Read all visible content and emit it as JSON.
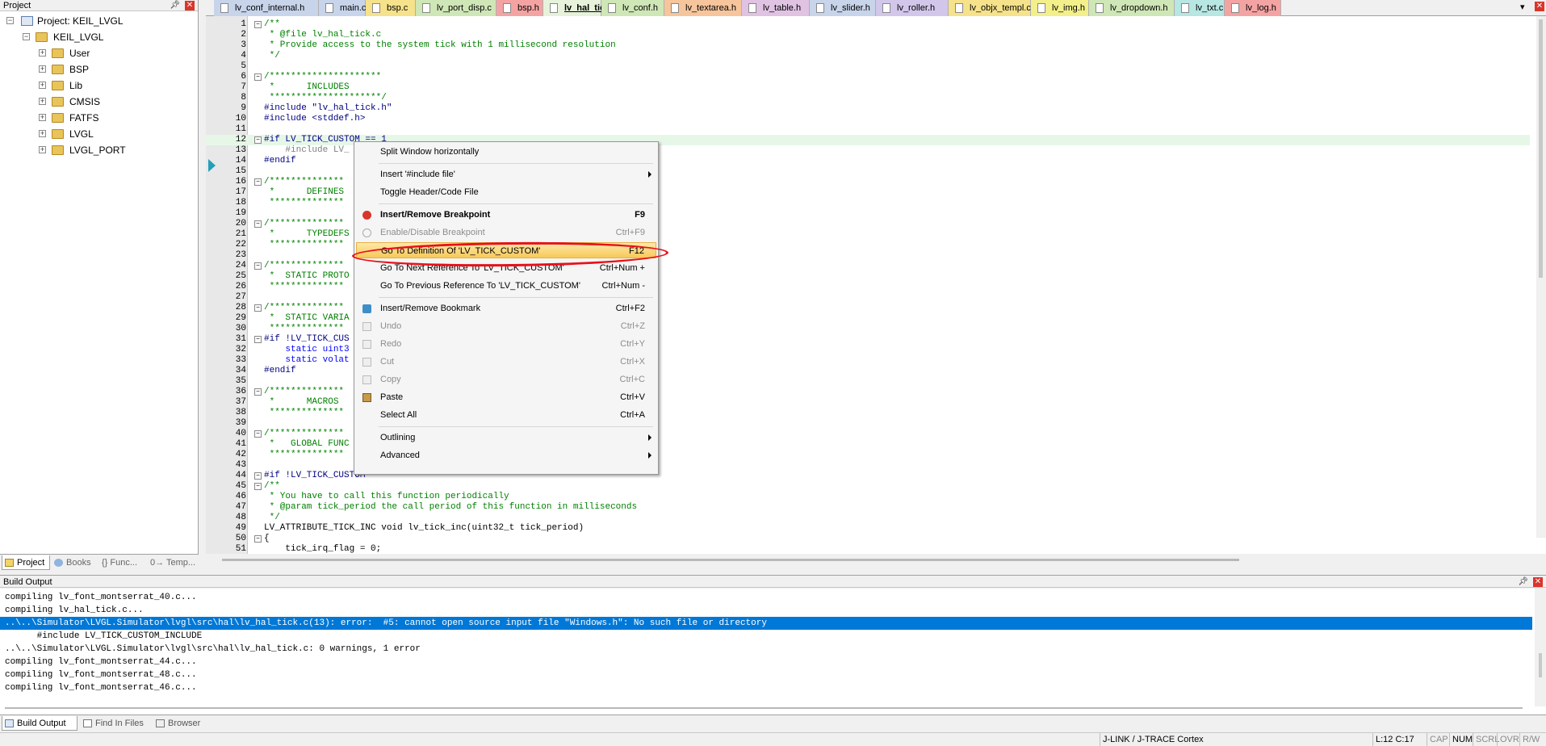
{
  "project_panel": {
    "title": "Project",
    "tree": [
      {
        "label": "Project: KEIL_LVGL",
        "kind": "project"
      },
      {
        "label": "KEIL_LVGL",
        "kind": "target"
      },
      {
        "label": "User",
        "kind": "folder"
      },
      {
        "label": "BSP",
        "kind": "folder"
      },
      {
        "label": "Lib",
        "kind": "folder"
      },
      {
        "label": "CMSIS",
        "kind": "folder"
      },
      {
        "label": "FATFS",
        "kind": "folder"
      },
      {
        "label": "LVGL",
        "kind": "folder"
      },
      {
        "label": "LVGL_PORT",
        "kind": "folder"
      }
    ],
    "tabs": [
      "Project",
      "Books",
      "{} Func...",
      "0→ Temp..."
    ]
  },
  "file_tabs": [
    {
      "label": "lv_conf_internal.h",
      "color": "#c7d4ea"
    },
    {
      "label": "main.c",
      "color": "#c7d4ea"
    },
    {
      "label": "bsp.c",
      "color": "#f6e28a"
    },
    {
      "label": "lv_port_disp.c",
      "color": "#cfe6b6"
    },
    {
      "label": "bsp.h",
      "color": "#f4a3a3"
    },
    {
      "label": "lv_hal_tick.c",
      "color": "#cfe6b6",
      "active": true
    },
    {
      "label": "lv_conf.h",
      "color": "#cfe6b6"
    },
    {
      "label": "lv_textarea.h",
      "color": "#f6c59b"
    },
    {
      "label": "lv_table.h",
      "color": "#e0c2e3"
    },
    {
      "label": "lv_slider.h",
      "color": "#c7d4ea"
    },
    {
      "label": "lv_roller.h",
      "color": "#d2c6ea"
    },
    {
      "label": "lv_objx_templ.c",
      "color": "#f6e28a"
    },
    {
      "label": "lv_img.h",
      "color": "#f3ef8a"
    },
    {
      "label": "lv_dropdown.h",
      "color": "#cfe6b6"
    },
    {
      "label": "lv_txt.c",
      "color": "#b7e6e3"
    },
    {
      "label": "lv_log.h",
      "color": "#f4a3a3"
    }
  ],
  "code_lines": [
    {
      "n": "1",
      "t": "/**",
      "c": "com",
      "fold": "-"
    },
    {
      "n": "2",
      "t": " * @file lv_hal_tick.c",
      "c": "com"
    },
    {
      "n": "3",
      "t": " * Provide access to the system tick with 1 millisecond resolution",
      "c": "com"
    },
    {
      "n": "4",
      "t": " */",
      "c": "com"
    },
    {
      "n": "5",
      "t": "",
      "c": ""
    },
    {
      "n": "6",
      "t": "/*********************",
      "c": "com",
      "fold": "-"
    },
    {
      "n": "7",
      "t": " *      INCLUDES",
      "c": "com"
    },
    {
      "n": "8",
      "t": " *********************/",
      "c": "com"
    },
    {
      "n": "9",
      "t": "#include \"lv_hal_tick.h\"",
      "c": "inc"
    },
    {
      "n": "10",
      "t": "#include <stddef.h>",
      "c": "inc"
    },
    {
      "n": "11",
      "t": "",
      "c": ""
    },
    {
      "n": "12",
      "t": "#if LV_TICK_CUSTOM == 1",
      "c": "pp",
      "fold": "-",
      "hl": true
    },
    {
      "n": "13",
      "t": "    #include LV_",
      "c": "grey"
    },
    {
      "n": "14",
      "t": "#endif",
      "c": "pp"
    },
    {
      "n": "15",
      "t": "",
      "c": ""
    },
    {
      "n": "16",
      "t": "/**************",
      "c": "com",
      "fold": "-"
    },
    {
      "n": "17",
      "t": " *      DEFINES",
      "c": "com"
    },
    {
      "n": "18",
      "t": " **************",
      "c": "com"
    },
    {
      "n": "19",
      "t": "",
      "c": ""
    },
    {
      "n": "20",
      "t": "/**************",
      "c": "com",
      "fold": "-"
    },
    {
      "n": "21",
      "t": " *      TYPEDEFS",
      "c": "com"
    },
    {
      "n": "22",
      "t": " **************",
      "c": "com"
    },
    {
      "n": "23",
      "t": "",
      "c": ""
    },
    {
      "n": "24",
      "t": "/**************",
      "c": "com",
      "fold": "-"
    },
    {
      "n": "25",
      "t": " *  STATIC PROTO",
      "c": "com"
    },
    {
      "n": "26",
      "t": " **************",
      "c": "com"
    },
    {
      "n": "27",
      "t": "",
      "c": ""
    },
    {
      "n": "28",
      "t": "/**************",
      "c": "com",
      "fold": "-"
    },
    {
      "n": "29",
      "t": " *  STATIC VARIA",
      "c": "com"
    },
    {
      "n": "30",
      "t": " **************",
      "c": "com"
    },
    {
      "n": "31",
      "t": "#if !LV_TICK_CUS",
      "c": "pp",
      "fold": "-"
    },
    {
      "n": "32",
      "t": "    static uint3",
      "c": "kw"
    },
    {
      "n": "33",
      "t": "    static volat",
      "c": "kw"
    },
    {
      "n": "34",
      "t": "#endif",
      "c": "pp"
    },
    {
      "n": "35",
      "t": "",
      "c": ""
    },
    {
      "n": "36",
      "t": "/**************",
      "c": "com",
      "fold": "-"
    },
    {
      "n": "37",
      "t": " *      MACROS",
      "c": "com"
    },
    {
      "n": "38",
      "t": " **************",
      "c": "com"
    },
    {
      "n": "39",
      "t": "",
      "c": ""
    },
    {
      "n": "40",
      "t": "/**************",
      "c": "com",
      "fold": "-"
    },
    {
      "n": "41",
      "t": " *   GLOBAL FUNC",
      "c": "com"
    },
    {
      "n": "42",
      "t": " **************",
      "c": "com"
    },
    {
      "n": "43",
      "t": "",
      "c": ""
    },
    {
      "n": "44",
      "t": "#if !LV_TICK_CUSTOM",
      "c": "pp",
      "fold": "-"
    },
    {
      "n": "45",
      "t": "/**",
      "c": "com",
      "fold": "-"
    },
    {
      "n": "46",
      "t": " * You have to call this function periodically",
      "c": "com"
    },
    {
      "n": "47",
      "t": " * @param tick_period the call period of this function in milliseconds",
      "c": "com"
    },
    {
      "n": "48",
      "t": " */",
      "c": "com"
    },
    {
      "n": "49",
      "t": "LV_ATTRIBUTE_TICK_INC void lv_tick_inc(uint32_t tick_period)",
      "c": "fn"
    },
    {
      "n": "50",
      "t": "{",
      "c": "",
      "fold": "-"
    },
    {
      "n": "51",
      "t": "    tick_irq_flag = 0;",
      "c": "assign"
    }
  ],
  "context_menu": {
    "items": [
      {
        "label": "Split Window horizontally",
        "shortcut": ""
      },
      {
        "sep": true
      },
      {
        "label": "Insert '#include file'",
        "shortcut": "",
        "submenu": true
      },
      {
        "label": "Toggle Header/Code File",
        "shortcut": ""
      },
      {
        "sep": true
      },
      {
        "label": "Insert/Remove Breakpoint",
        "shortcut": "F9",
        "bold": true,
        "icon": "breakpoint-icon"
      },
      {
        "label": "Enable/Disable Breakpoint",
        "shortcut": "Ctrl+F9",
        "disabled": true,
        "icon": "breakpoint-outline-icon"
      },
      {
        "label": "Go To Definition Of 'LV_TICK_CUSTOM'",
        "shortcut": "F12",
        "selected": true
      },
      {
        "label": "Go To Next Reference To 'LV_TICK_CUSTOM'",
        "shortcut": "Ctrl+Num +"
      },
      {
        "label": "Go To Previous Reference To 'LV_TICK_CUSTOM'",
        "shortcut": "Ctrl+Num -"
      },
      {
        "sep": true
      },
      {
        "label": "Insert/Remove Bookmark",
        "shortcut": "Ctrl+F2",
        "icon": "bookmark-icon"
      },
      {
        "label": "Undo",
        "shortcut": "Ctrl+Z",
        "disabled": true,
        "icon": "undo-icon"
      },
      {
        "label": "Redo",
        "shortcut": "Ctrl+Y",
        "disabled": true,
        "icon": "redo-icon"
      },
      {
        "label": "Cut",
        "shortcut": "Ctrl+X",
        "disabled": true,
        "icon": "cut-icon"
      },
      {
        "label": "Copy",
        "shortcut": "Ctrl+C",
        "disabled": true,
        "icon": "copy-icon"
      },
      {
        "label": "Paste",
        "shortcut": "Ctrl+V",
        "icon": "paste-icon"
      },
      {
        "label": "Select All",
        "shortcut": "Ctrl+A"
      },
      {
        "sep": true
      },
      {
        "label": "Outlining",
        "shortcut": "",
        "submenu": true
      },
      {
        "label": "Advanced",
        "shortcut": "",
        "submenu": true
      }
    ]
  },
  "build_output": {
    "title": "Build Output",
    "lines": [
      {
        "text": "compiling lv_font_montserrat_40.c..."
      },
      {
        "text": "compiling lv_hal_tick.c..."
      },
      {
        "text": "..\\..\\Simulator\\LVGL.Simulator\\lvgl\\src\\hal\\lv_hal_tick.c(13): error:  #5: cannot open source input file \"Windows.h\": No such file or directory",
        "error": true
      },
      {
        "text": "      #include LV_TICK_CUSTOM_INCLUDE"
      },
      {
        "text": "..\\..\\Simulator\\LVGL.Simulator\\lvgl\\src\\hal\\lv_hal_tick.c: 0 warnings, 1 error"
      },
      {
        "text": "compiling lv_font_montserrat_44.c..."
      },
      {
        "text": "compiling lv_font_montserrat_48.c..."
      },
      {
        "text": "compiling lv_font_montserrat_46.c..."
      }
    ],
    "tabs": [
      "Build Output",
      "Find In Files",
      "Browser"
    ]
  },
  "status_bar": {
    "debugger": "J-LINK / J-TRACE Cortex",
    "position": "L:12 C:17",
    "cap": "CAP",
    "num": "NUM",
    "scrl": "SCRL",
    "ovr": "OVR",
    "rw": "R/W"
  }
}
